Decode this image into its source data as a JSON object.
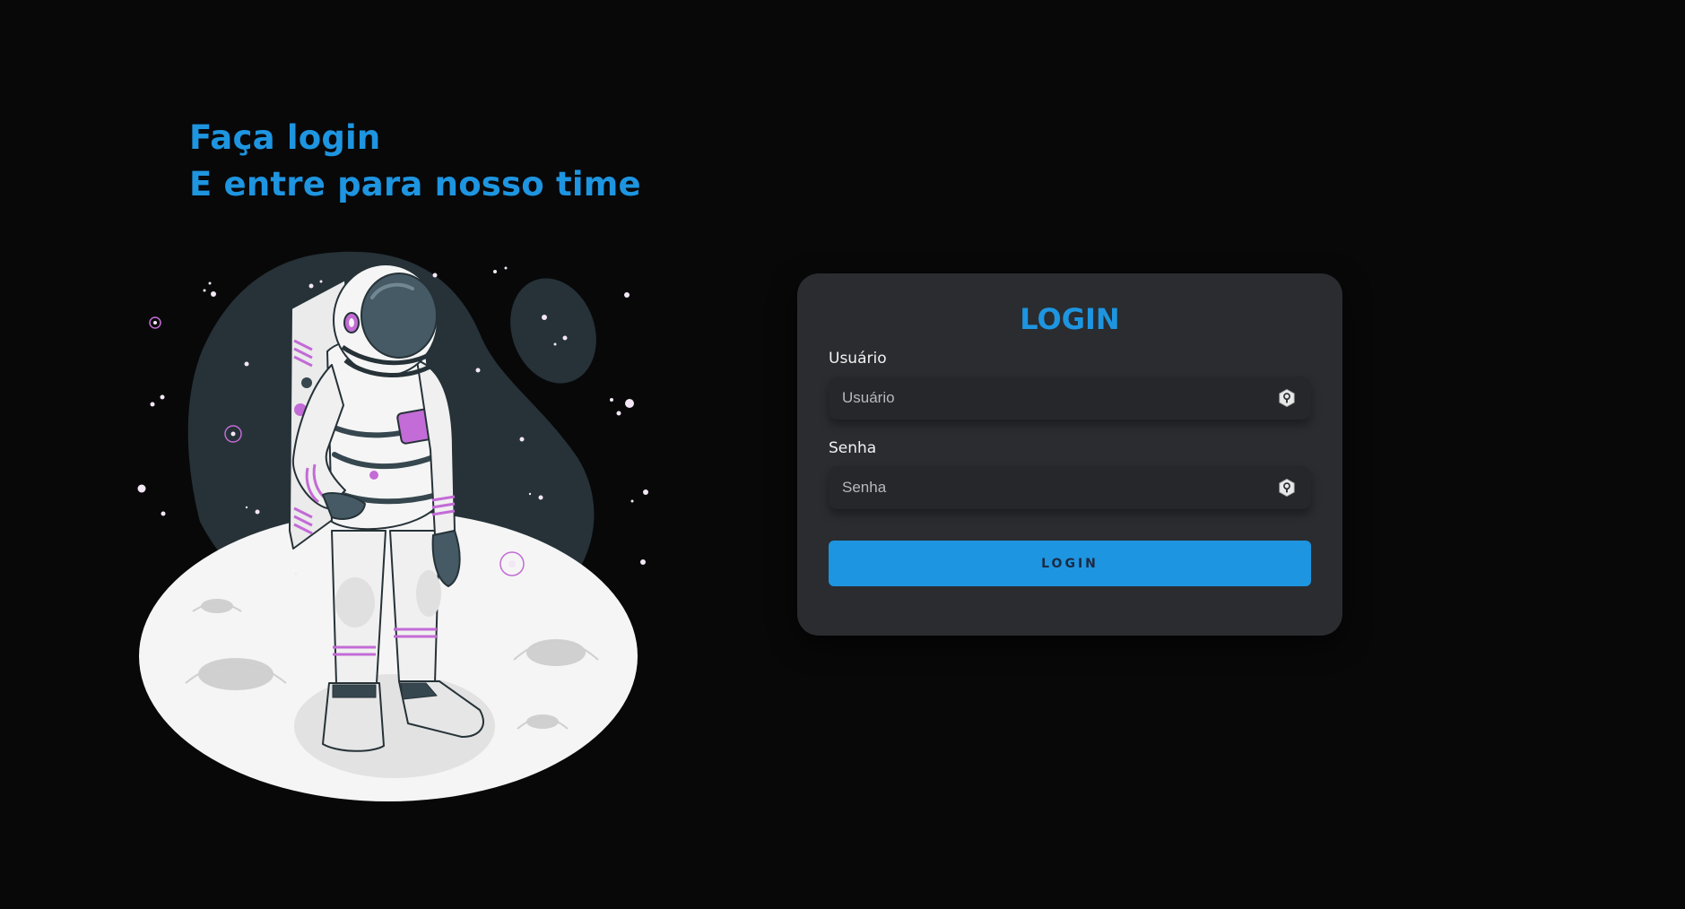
{
  "heading": {
    "line1": "Faça login",
    "line2": "E entre para nosso time"
  },
  "login_card": {
    "title": "LOGIN",
    "username": {
      "label": "Usuário",
      "placeholder": "Usuário",
      "value": "",
      "icon": "lock-icon"
    },
    "password": {
      "label": "Senha",
      "placeholder": "Senha",
      "value": "",
      "icon": "lock-icon"
    },
    "submit_label": "LOGIN"
  },
  "illustration": {
    "subject": "astronaut-on-moon"
  },
  "colors": {
    "background": "#080809",
    "accent": "#1e95e0",
    "card": "#2a2c30",
    "input": "#25272b",
    "suit_accent": "#c36bd6",
    "blob": "#263238",
    "moon": "#f5f5f5"
  }
}
